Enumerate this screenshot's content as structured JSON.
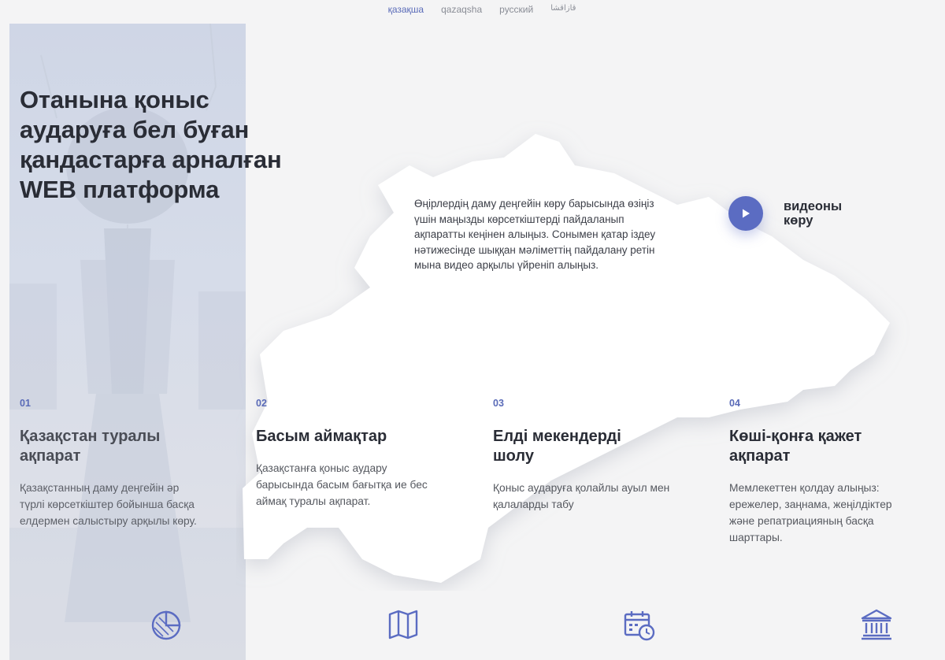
{
  "languages": [
    {
      "label": "қазақша",
      "active": true
    },
    {
      "label": "qazaqsha",
      "active": false
    },
    {
      "label": "русский",
      "active": false
    },
    {
      "label": "قازاقشا",
      "active": false
    }
  ],
  "hero": {
    "title_lines": [
      "Отанына қоныс",
      "аударуға бел буған",
      "қандастарға арналған",
      "WEB платформа"
    ]
  },
  "intro": {
    "text": "Өңірлердің даму деңгейін көру барысында өзіңіз үшін маңызды көрсеткіштерді пайдаланып ақпаратты кеңінен алыңыз. Сонымен қатар іздеу нәтижесінде шыққан мәліметтің пайдалану ретін мына видео арқылы үйреніп алыңыз."
  },
  "video": {
    "label_line1": "видеоны",
    "label_line2": "көру",
    "icon": "play-icon"
  },
  "features": [
    {
      "num": "01",
      "title_line1": "Қазақстан туралы",
      "title_line2": "ақпарат",
      "desc": "Қазақстанның даму деңгейін әр түрлі көрсеткіштер бойынша басқа елдермен салыстыру арқылы көру.",
      "icon": "pie-chart-icon"
    },
    {
      "num": "02",
      "title_line1": "Басым аймақтар",
      "title_line2": "",
      "desc": "Қазақстанға қоныс аудару барысында басым бағытқа ие бес аймақ туралы ақпарат.",
      "icon": "map-icon"
    },
    {
      "num": "03",
      "title_line1": "Елді мекендерді",
      "title_line2": "шолу",
      "desc": "Қоныс аударуға қолайлы ауыл мен қалаларды табу",
      "icon": "calendar-clock-icon"
    },
    {
      "num": "04",
      "title_line1": "Көші-қонға қажет",
      "title_line2": "ақпарат",
      "desc": "Мемлекеттен қолдау алыңыз: ережелер, заңнама, жеңілдіктер және репатриацияның басқа шарттары.",
      "icon": "government-building-icon"
    }
  ],
  "colors": {
    "accent": "#5b6cc2",
    "background": "#f4f4f5",
    "text": "#2a2d36",
    "panel": "#d3d9e7"
  }
}
